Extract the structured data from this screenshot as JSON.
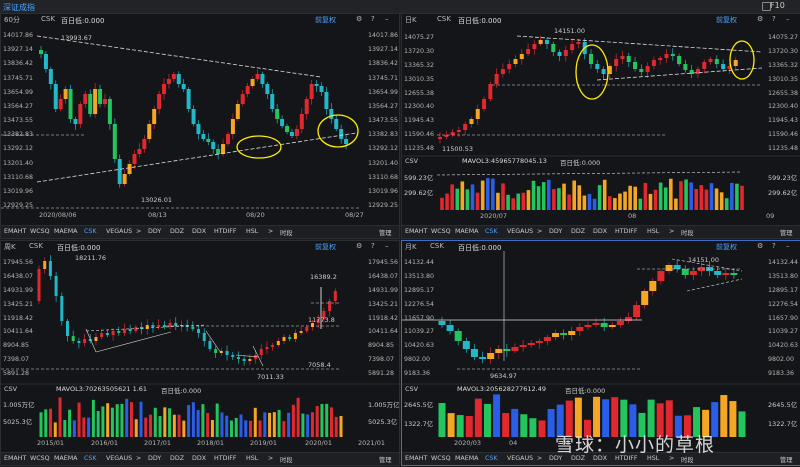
{
  "app": {
    "title": "深证成指",
    "f10": "F10"
  },
  "colors": {
    "up": "#e0282e",
    "down": "#22b8c8",
    "volOrange": "#f5a623",
    "volBlue": "#2a5de8",
    "volGreen": "#22c55e",
    "accent": "#4aa3ff"
  },
  "tabs": [
    "EMAHT",
    "WCSQ",
    "MAEMA",
    "CSK",
    "VEGAUS",
    ">",
    "DDY",
    "DDZ",
    "DDX",
    "HTDIFF",
    "HSL",
    ">",
    "时段",
    "管理"
  ],
  "tabs_selected": "CSK",
  "watermark": "雪球：小小的草根",
  "panels": {
    "tl": {
      "period": "60分",
      "indicator": "CSK",
      "ref": "百日低:0.000",
      "adjust": "前复权",
      "y_labels": [
        "14017.86",
        "13927.14",
        "13836.42",
        "13745.71",
        "13654.99",
        "13564.27",
        "13473.55",
        "13382.83",
        "13292.12",
        "13201.40",
        "13110.68",
        "13019.96",
        "12929.25"
      ],
      "x_labels": [
        "2020/08/06",
        "08/13",
        "08/20",
        "08/27"
      ],
      "annotations": [
        "13993.67",
        "13026.01"
      ]
    },
    "tr": {
      "period": "日K",
      "indicator": "CSK",
      "ref": "百日低:0.000",
      "adjust": "前复权",
      "y_labels": [
        "14075.27",
        "13720.30",
        "13365.32",
        "13010.35",
        "12655.38",
        "12300.40",
        "11945.43",
        "11590.46",
        "11235.48"
      ],
      "x_labels": [
        "2020/07",
        "08",
        "09"
      ],
      "annotations": [
        "14151.00",
        "11500.53"
      ],
      "vol_legend": "MAVOL3:45965778045.13",
      "vol_ref": "百日低:0.000",
      "vol_title": "CSV",
      "vol_labels": [
        "599.23亿",
        "299.62亿"
      ]
    },
    "bl": {
      "period": "周K",
      "indicator": "CSK",
      "ref": "百日低:0.000",
      "adjust": "前复权",
      "y_labels": [
        "17945.56",
        "16438.07",
        "14931.99",
        "13425.21",
        "11918.42",
        "10411.64",
        "8904.85",
        "7398.07",
        "5891.28"
      ],
      "x_labels": [
        "2015/01",
        "2016/01",
        "2017/01",
        "2018/01",
        "2019/01",
        "2020/01",
        "2021/01"
      ],
      "annotations": [
        "18211.76",
        "16389.2",
        "11773.8",
        "7058.4",
        "7011.33"
      ],
      "vol_legend": "MAVOL3:70263505621 1.61",
      "vol_ref": "百日低:0.000",
      "vol_title": "CSV",
      "vol_labels": [
        "1.005万亿",
        "5025.3亿"
      ]
    },
    "br": {
      "period": "月K",
      "indicator": "CSK",
      "ref": "百日低:0.000",
      "adjust": "前复权",
      "y_labels": [
        "14132.44",
        "13513.80",
        "12895.17",
        "12276.54",
        "11657.90",
        "11039.27",
        "10420.63",
        "9802.00",
        "9183.36"
      ],
      "x_labels": [
        "2020/03",
        "04",
        "05"
      ],
      "annotations": [
        "14151.00",
        "9634.97"
      ],
      "vol_legend": "MAVOL3:205628277612.49",
      "vol_ref": "百日低:0.000",
      "vol_title": "CSV",
      "vol_labels": [
        "2645.5亿",
        "1322.7亿"
      ]
    }
  }
}
